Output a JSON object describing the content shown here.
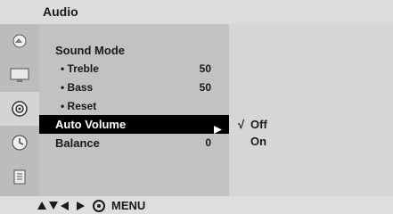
{
  "header": {
    "title": "Audio"
  },
  "icons": [
    "picture-icon",
    "screen-icon",
    "audio-icon",
    "time-icon",
    "option-icon"
  ],
  "menu": {
    "items": [
      {
        "label": "Sound Mode",
        "value": ""
      },
      {
        "label": "• Treble",
        "value": "50"
      },
      {
        "label": "• Bass",
        "value": "50"
      },
      {
        "label": "• Reset",
        "value": ""
      },
      {
        "label": "Auto Volume",
        "value": ""
      },
      {
        "label": "Balance",
        "value": "0"
      }
    ],
    "selected_index": 4
  },
  "submenu": {
    "options": [
      {
        "label": "Off",
        "checked": true,
        "check_mark": "√"
      },
      {
        "label": "On",
        "checked": false,
        "check_mark": ""
      }
    ]
  },
  "footer": {
    "label": "MENU"
  },
  "colors": {
    "selection_bg": "#000000",
    "menu_bg": "#c2c2c2",
    "submenu_bg": "#d6d6d6"
  }
}
